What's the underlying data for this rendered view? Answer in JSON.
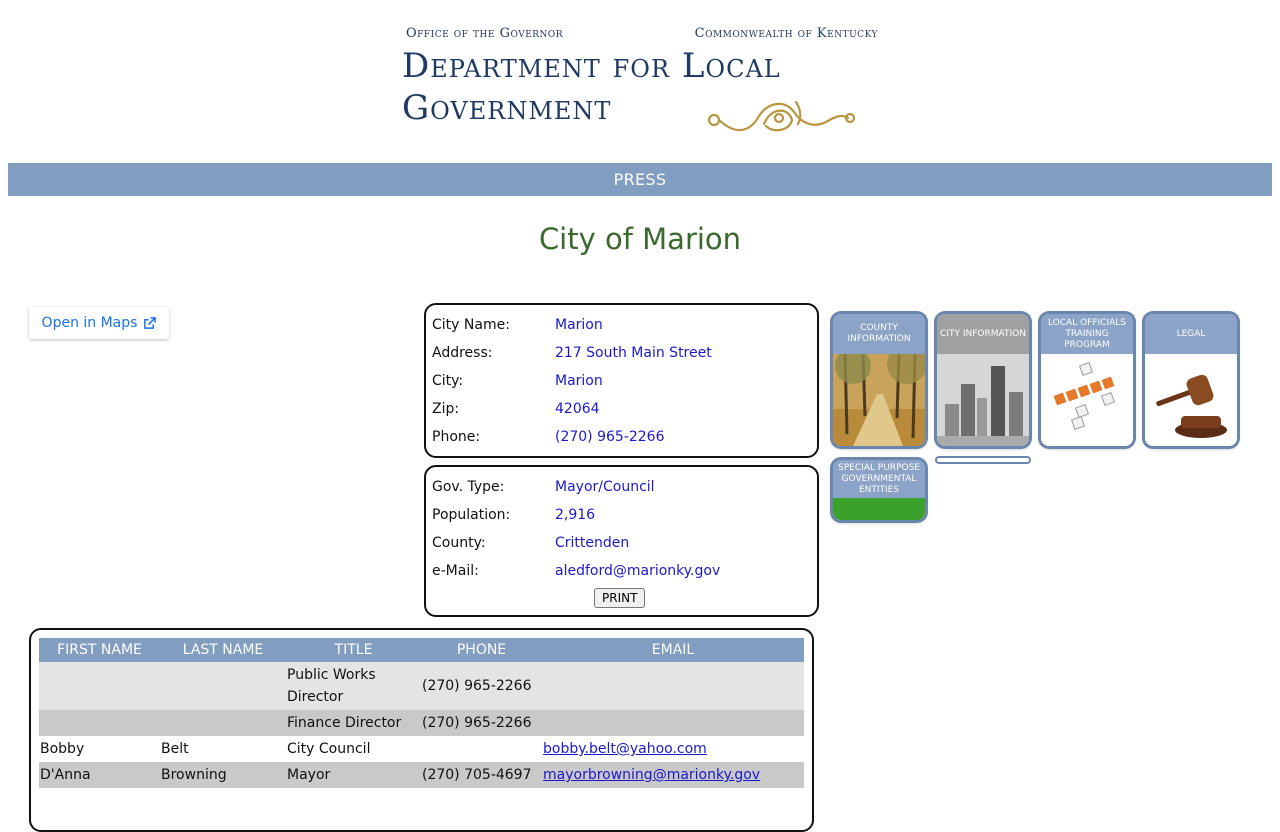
{
  "header": {
    "left_sub": "Office of the Governor",
    "right_sub": "Commonwealth of Kentucky",
    "line1": "Department for Local",
    "line2": "Government"
  },
  "nav": {
    "press": "PRESS"
  },
  "page_title": "City of Marion",
  "maps": {
    "label": "Open in Maps"
  },
  "city": {
    "labels": {
      "name": "City Name:",
      "address": "Address:",
      "city": "City:",
      "zip": "Zip:",
      "phone": "Phone:"
    },
    "name": "Marion",
    "address": "217 South Main Street",
    "city": "Marion",
    "zip": "42064",
    "phone": "(270) 965-2266"
  },
  "gov": {
    "labels": {
      "type": "Gov. Type:",
      "population": "Population:",
      "county": "County:",
      "email": "e-Mail:"
    },
    "type": "Mayor/Council",
    "population": "2,916",
    "county": "Crittenden",
    "email": "aledford@marionky.gov",
    "print_label": "PRINT"
  },
  "tiles": [
    {
      "label": "County Information"
    },
    {
      "label": "City Information"
    },
    {
      "label": "Local Officials Training Program"
    },
    {
      "label": "Legal"
    },
    {
      "label": "Special Purpose Governmental Entities"
    }
  ],
  "officials": {
    "headers": [
      "FIRST NAME",
      "LAST NAME",
      "TITLE",
      "PHONE",
      "EMAIL"
    ],
    "rows": [
      {
        "first": "",
        "last": "",
        "title": "Public Works Director",
        "phone": "(270) 965-2266",
        "email": ""
      },
      {
        "first": "",
        "last": "",
        "title": "Finance Director",
        "phone": "(270) 965-2266",
        "email": ""
      },
      {
        "first": "Bobby",
        "last": "Belt",
        "title": "City Council",
        "phone": "",
        "email": "bobby.belt@yahoo.com"
      },
      {
        "first": "D'Anna",
        "last": "Browning",
        "title": "Mayor",
        "phone": "(270) 705-4697",
        "email": "mayorbrowning@marionky.gov"
      }
    ]
  }
}
